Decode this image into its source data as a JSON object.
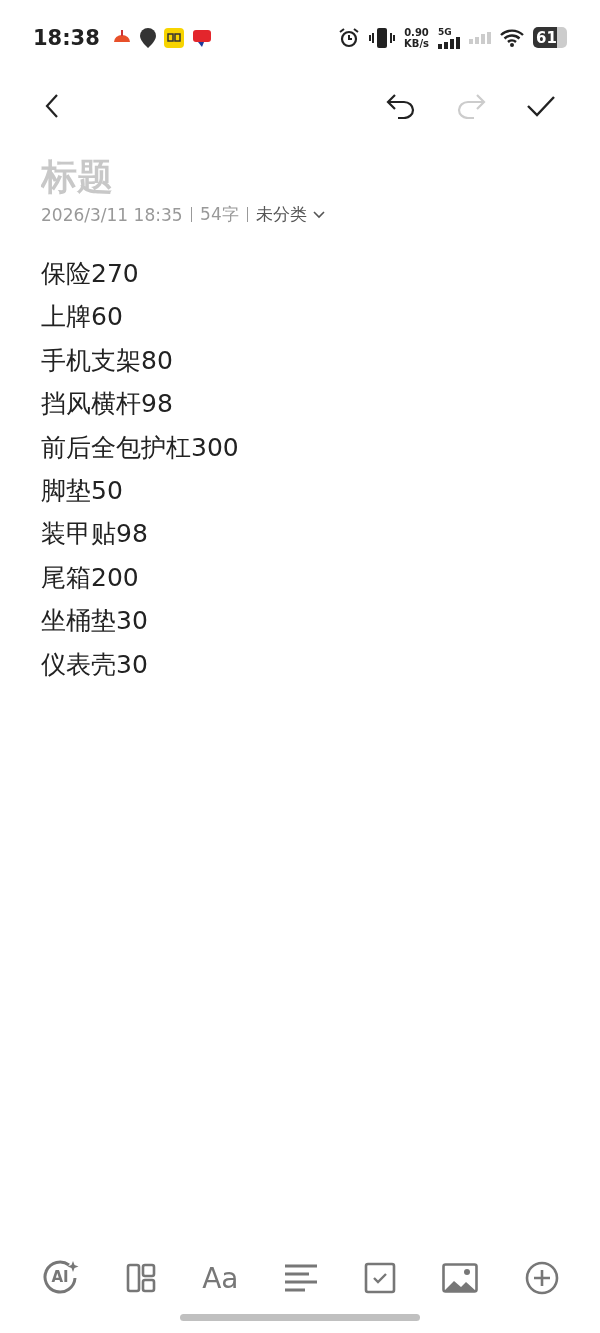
{
  "status_bar": {
    "time": "18:38",
    "net_speed_value": "0.90",
    "net_speed_unit": "KB/s",
    "network": "5G",
    "battery": "61"
  },
  "title": {
    "placeholder": "标题"
  },
  "meta": {
    "datetime": "2026/3/11 18:35",
    "count": "54字",
    "category": "未分类"
  },
  "lines": [
    "保险270",
    "上牌60",
    "手机支架80",
    "挡风横杆98",
    "前后全包护杠300",
    "脚垫50",
    "装甲贴98",
    "尾箱200",
    "坐桶垫30",
    "仪表壳30"
  ],
  "toolbar": [
    {
      "kind": "ai",
      "label": "AI"
    },
    {
      "kind": "layout"
    },
    {
      "kind": "font",
      "label": "Aa"
    },
    {
      "kind": "align"
    },
    {
      "kind": "checkbox"
    },
    {
      "kind": "image"
    },
    {
      "kind": "add"
    }
  ]
}
